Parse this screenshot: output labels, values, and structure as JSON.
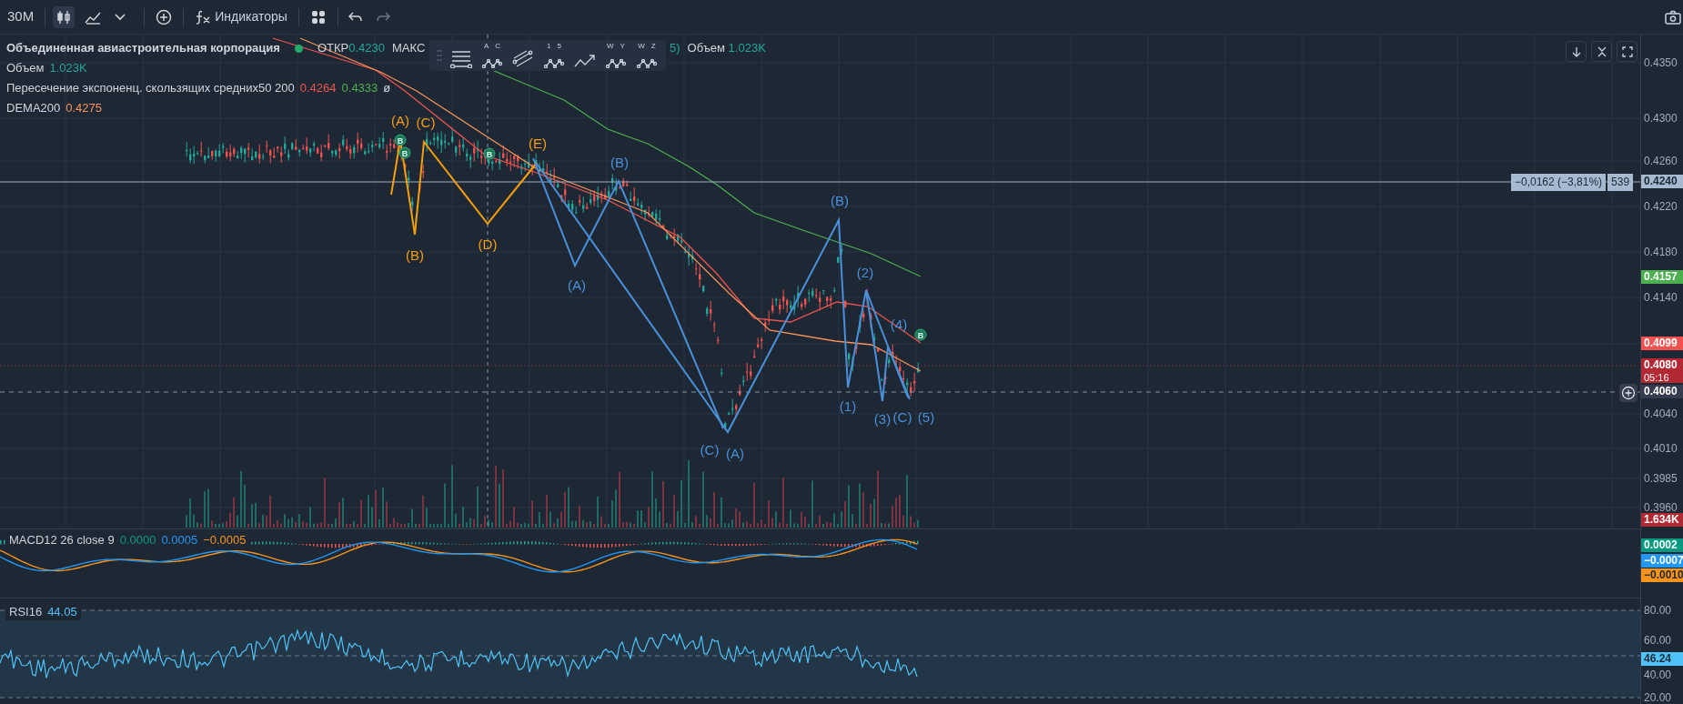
{
  "toolbar": {
    "interval": "30M",
    "chart_types": [
      {
        "kind": "candles",
        "selected": true
      },
      {
        "kind": "area",
        "selected": false
      }
    ],
    "indicators_label": "Индикаторы"
  },
  "legend": {
    "symbol": "Объединенная авиастроительная корпорация",
    "open_label": "ОТКР",
    "open_value": "0.4230",
    "high_label": "МАКС",
    "cut_fragment": "5)",
    "volume_label": "Объем",
    "volume_value": "1.023K",
    "indicators": [
      {
        "name": "Объем",
        "values": [
          {
            "text": "1.023K",
            "color": "#26a69a"
          }
        ]
      },
      {
        "name": "Пересечение экспоненц. скользящих средних50 200",
        "values": [
          {
            "text": "0.4264",
            "color": "#ef5350"
          },
          {
            "text": "0.4333",
            "color": "#4caf50"
          },
          {
            "text": "ø",
            "color": "#d1d4dc"
          }
        ]
      },
      {
        "name": "DEMA200",
        "values": [
          {
            "text": "0.4275",
            "color": "#f7925a"
          }
        ]
      }
    ]
  },
  "drawing_tools": [
    {
      "kind": "lines"
    },
    {
      "kind": "wave",
      "labels": [
        "A",
        "C"
      ]
    },
    {
      "kind": "channel"
    },
    {
      "kind": "wave",
      "labels": [
        "1",
        "5"
      ]
    },
    {
      "kind": "arrow"
    },
    {
      "kind": "wave",
      "labels": [
        "W",
        "Y"
      ]
    },
    {
      "kind": "wave",
      "labels": [
        "W",
        "Z"
      ]
    }
  ],
  "measure": {
    "change": "−0,0162 (−3,81%)",
    "bars": "539"
  },
  "wave_labels": [
    {
      "text": "(A)",
      "color": "#f59e0b"
    },
    {
      "text": "(C)",
      "color": "#f59e0b"
    },
    {
      "text": "(B)",
      "color": "#f59e0b"
    },
    {
      "text": "(D)",
      "color": "#f59e0b"
    },
    {
      "text": "(E)",
      "color": "#f59e0b"
    },
    {
      "text": "(B)",
      "color": "#4a90d9"
    },
    {
      "text": "(A)",
      "color": "#4a90d9"
    },
    {
      "text": "(C)",
      "color": "#4a90d9"
    },
    {
      "text": "(A)",
      "color": "#4a90d9"
    },
    {
      "text": "(B)",
      "color": "#4a90d9"
    },
    {
      "text": "(2)",
      "color": "#4a90d9"
    },
    {
      "text": "(4)",
      "color": "#4a90d9"
    },
    {
      "text": "(1)",
      "color": "#4a90d9"
    },
    {
      "text": "(3)",
      "color": "#4a90d9"
    },
    {
      "text": "(C)",
      "color": "#4a90d9"
    },
    {
      "text": "(5)",
      "color": "#4a90d9"
    }
  ],
  "signals": [
    "B",
    "B",
    "B",
    "B"
  ],
  "price_axis": {
    "ticks": [
      "0.4350",
      "0.4300",
      "0.4260",
      "0.4220",
      "0.4180",
      "0.4140",
      "0.4040",
      "0.4010",
      "0.3985",
      "0.3960",
      "80.00",
      "60.00",
      "40.00",
      "20.00"
    ],
    "markers": [
      {
        "text": "0.4240",
        "color": "#a5b9d0"
      },
      {
        "text": "0.4157",
        "color": "#4caf50"
      },
      {
        "text": "0.4099",
        "color": "#f05350"
      },
      {
        "text": "0.4080",
        "countdown": "05:16",
        "color": "#b22833"
      },
      {
        "text": "0.4060",
        "color": "#363c4e"
      },
      {
        "text": "1.634K",
        "color": "#b22833"
      },
      {
        "text": "0.0002",
        "color": "#089981"
      },
      {
        "text": "−0.0007",
        "color": "#2196f3"
      },
      {
        "text": "−0.0010",
        "color": "#f7931a"
      },
      {
        "text": "46.24",
        "color": "#4fc3f7"
      }
    ]
  },
  "macd": {
    "title": "MACD12 26 close 9",
    "values": [
      {
        "text": "0.0000",
        "color": "#089981"
      },
      {
        "text": "0.0005",
        "color": "#2196f3"
      },
      {
        "text": "−0.0005",
        "color": "#f7931a"
      }
    ]
  },
  "rsi": {
    "title": "RSI16",
    "value": "44.05"
  }
}
